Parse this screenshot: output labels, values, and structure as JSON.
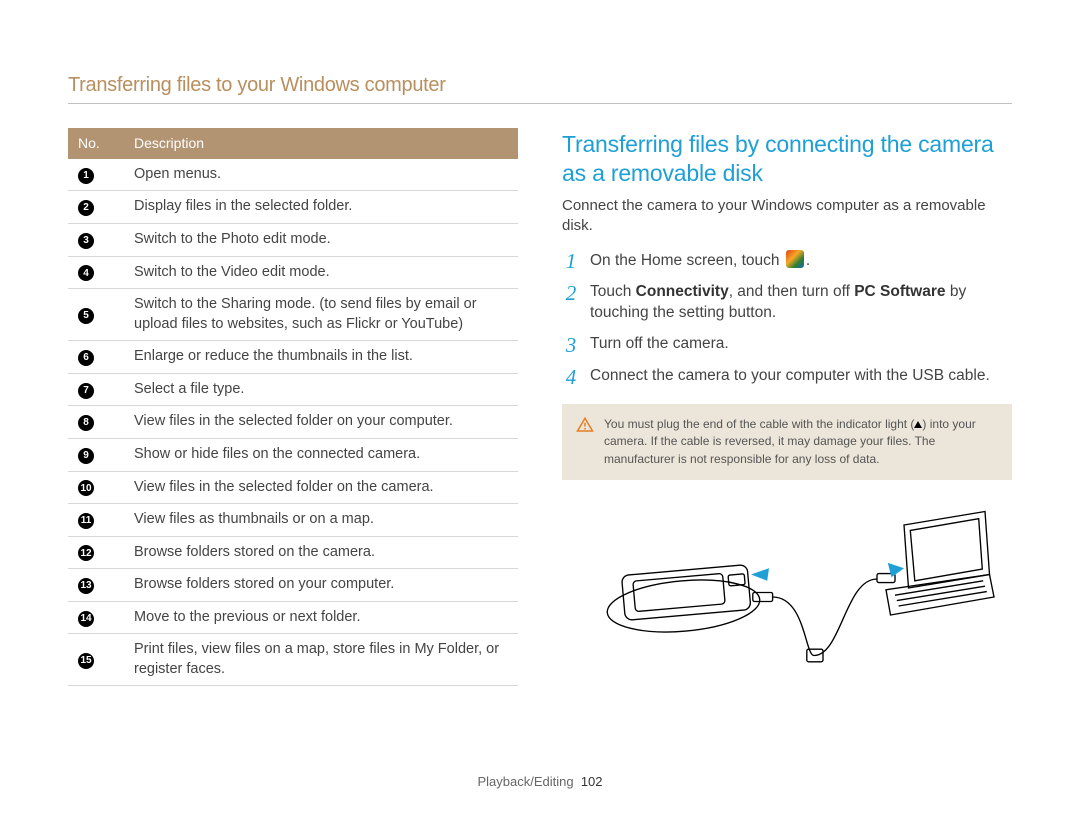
{
  "page_title": "Transferring files to your Windows computer",
  "table": {
    "header_no": "No.",
    "header_desc": "Description",
    "rows": [
      "Open menus.",
      "Display files in the selected folder.",
      "Switch to the Photo edit mode.",
      "Switch to the Video edit mode.",
      "Switch to the Sharing mode. (to send files by email or upload files to websites, such as Flickr or YouTube)",
      "Enlarge or reduce the thumbnails in the list.",
      "Select a file type.",
      "View files in the selected folder on your computer.",
      "Show or hide files on the connected camera.",
      "View files in the selected folder on the camera.",
      "View files as thumbnails or on a map.",
      "Browse folders stored on the camera.",
      "Browse folders stored on your computer.",
      "Move to the previous or next folder.",
      "Print files, view files on a map, store files in My Folder, or register faces."
    ]
  },
  "section_heading": "Transferring files by connecting the camera as a removable disk",
  "intro": "Connect the camera to your Windows computer as a removable disk.",
  "steps": {
    "s1_a": "On the Home screen, touch ",
    "s1_b": ".",
    "s2_a": "Touch ",
    "s2_bold1": "Connectivity",
    "s2_b": ", and then turn off ",
    "s2_bold2": "PC Software",
    "s2_c": " by touching the setting button.",
    "s3": "Turn off the camera.",
    "s4": "Connect the camera to your computer with the USB cable."
  },
  "caution": {
    "line1_a": "You must plug the end of the cable with the indicator light (",
    "line1_b": ") into your camera. If the cable is reversed, it may damage your files. The manufacturer is not responsible for any loss of data."
  },
  "footer_section": "Playback/Editing",
  "footer_page": "102"
}
